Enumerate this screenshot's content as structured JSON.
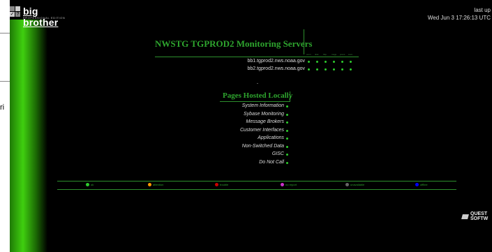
{
  "header": {
    "brand": "big brother",
    "edition": "PROFESSIONAL EDITION",
    "last_update_label": "last up",
    "timestamp": "Wed Jun 3 17:26:13 UTC"
  },
  "side": {
    "fragment": "ri"
  },
  "main": {
    "title": "NWSTG TGPROD2 Monitoring Servers",
    "columns": [
      "conn",
      "disk",
      "http",
      "msgs",
      "procs",
      "svcs"
    ],
    "servers": [
      {
        "name": "bb1.tgprod2.nws.noaa.gov",
        "status": "green"
      },
      {
        "name": "bb2.tgprod2.nws.noaa.gov",
        "status": "green"
      }
    ]
  },
  "pages": {
    "title": "Pages Hosted Locally",
    "items": [
      "System Information",
      "Sybase Monitoring",
      "Message Brokers",
      "Customer Interfaces",
      "Applications",
      "Non-Switched Data",
      "GISC",
      "Do Not Call"
    ]
  },
  "legend": [
    {
      "label": "ok",
      "color": "#2ecc2e"
    },
    {
      "label": "attention",
      "color": "#ff9900"
    },
    {
      "label": "trouble",
      "color": "#cc0000"
    },
    {
      "label": "no report",
      "color": "#cc33cc"
    },
    {
      "label": "unavailable",
      "color": "#666666"
    },
    {
      "label": "offline",
      "color": "#0000ff"
    }
  ],
  "footer": {
    "vendor_line1": "QUEST",
    "vendor_line2": "SOFTW"
  },
  "colors": {
    "accent": "#2ea52e",
    "status_green": "#2ecc2e"
  }
}
